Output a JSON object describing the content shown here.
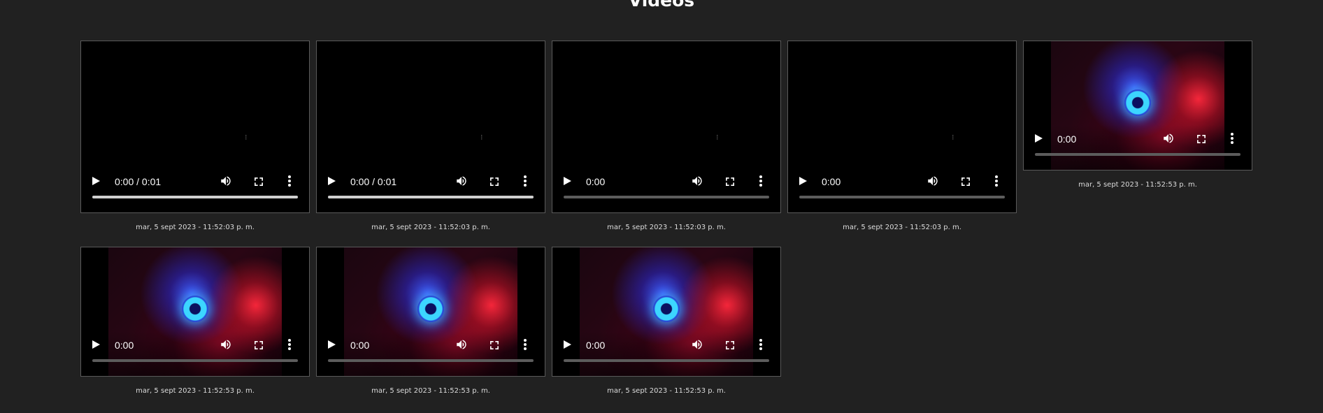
{
  "page": {
    "title": "Videos"
  },
  "videos": [
    {
      "caption": "mar, 5 sept 2023 - 11:52:03 p. m.",
      "time": "0:00 / 0:01",
      "played_fraction": 1.0,
      "state": "loading"
    },
    {
      "caption": "mar, 5 sept 2023 - 11:52:03 p. m.",
      "time": "0:00 / 0:01",
      "played_fraction": 1.0,
      "state": "loading"
    },
    {
      "caption": "mar, 5 sept 2023 - 11:52:03 p. m.",
      "time": "0:00",
      "played_fraction": 0,
      "state": "loading"
    },
    {
      "caption": "mar, 5 sept 2023 - 11:52:03 p. m.",
      "time": "0:00",
      "played_fraction": 0,
      "state": "loading"
    },
    {
      "caption": "mar, 5 sept 2023 - 11:52:53 p. m.",
      "time": "0:00",
      "played_fraction": 0,
      "state": "frame"
    },
    {
      "caption": "mar, 5 sept 2023 - 11:52:53 p. m.",
      "time": "0:00",
      "played_fraction": 0,
      "state": "frame"
    },
    {
      "caption": "mar, 5 sept 2023 - 11:52:53 p. m.",
      "time": "0:00",
      "played_fraction": 0,
      "state": "frame"
    },
    {
      "caption": "mar, 5 sept 2023 - 11:52:53 p. m.",
      "time": "0:00",
      "played_fraction": 0,
      "state": "frame"
    }
  ],
  "icons": {
    "play": "play-icon",
    "volume": "volume-icon",
    "fullscreen": "fullscreen-icon",
    "more": "more-options-icon",
    "loading": "loading-spinner-icon"
  },
  "colors": {
    "background": "#212121",
    "player_border": "#5a5a5a",
    "progress_track": "#5c5c5c",
    "progress_fill": "#cfcfcf"
  }
}
